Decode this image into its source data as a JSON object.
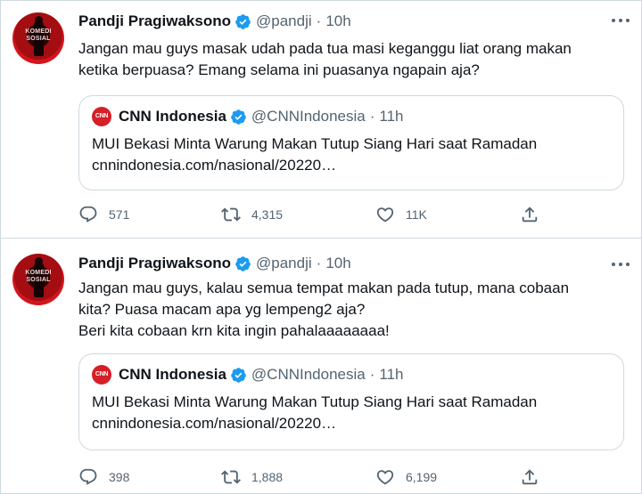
{
  "tweets": [
    {
      "author": {
        "name": "Pandji Pragiwaksono",
        "handle": "@pandji",
        "avatar_text": "KOMEDI SOSIAL"
      },
      "time": "10h",
      "text_lines": [
        "Jangan mau guys masak udah pada tua masi keganggu liat orang makan",
        "ketika berpuasa? Emang selama ini puasanya ngapain aja?"
      ],
      "quote": {
        "name": "CNN Indonesia",
        "handle": "@CNNIndonesia",
        "time": "11h",
        "logo_text": "CNN",
        "lines": [
          "MUI Bekasi Minta Warung Makan Tutup Siang Hari saat Ramadan",
          "cnnindonesia.com/nasional/20220…"
        ]
      },
      "stats": {
        "replies": "571",
        "retweets": "4,315",
        "likes": "11K"
      }
    },
    {
      "author": {
        "name": "Pandji Pragiwaksono",
        "handle": "@pandji",
        "avatar_text": "KOMEDI SOSIAL"
      },
      "time": "10h",
      "text_lines": [
        "Jangan mau guys, kalau semua tempat makan pada tutup, mana cobaan",
        "kita? Puasa macam apa yg lempeng2 aja?",
        "Beri kita cobaan krn kita ingin pahalaaaaaaaa!"
      ],
      "quote": {
        "name": "CNN Indonesia",
        "handle": "@CNNIndonesia",
        "time": "11h",
        "logo_text": "CNN",
        "lines": [
          "MUI Bekasi Minta Warung Makan Tutup Siang Hari saat Ramadan",
          "cnnindonesia.com/nasional/20220…"
        ]
      },
      "stats": {
        "replies": "398",
        "retweets": "1,888",
        "likes": "6,199"
      }
    }
  ],
  "separator": "·",
  "icons": [
    "verified-badge-icon",
    "more-icon",
    "reply-icon",
    "retweet-icon",
    "like-icon",
    "share-icon"
  ],
  "colors": {
    "verified": "#1d9bf0",
    "muted": "#536471",
    "border": "#cfd9de",
    "cnn_red": "#d61f26"
  }
}
